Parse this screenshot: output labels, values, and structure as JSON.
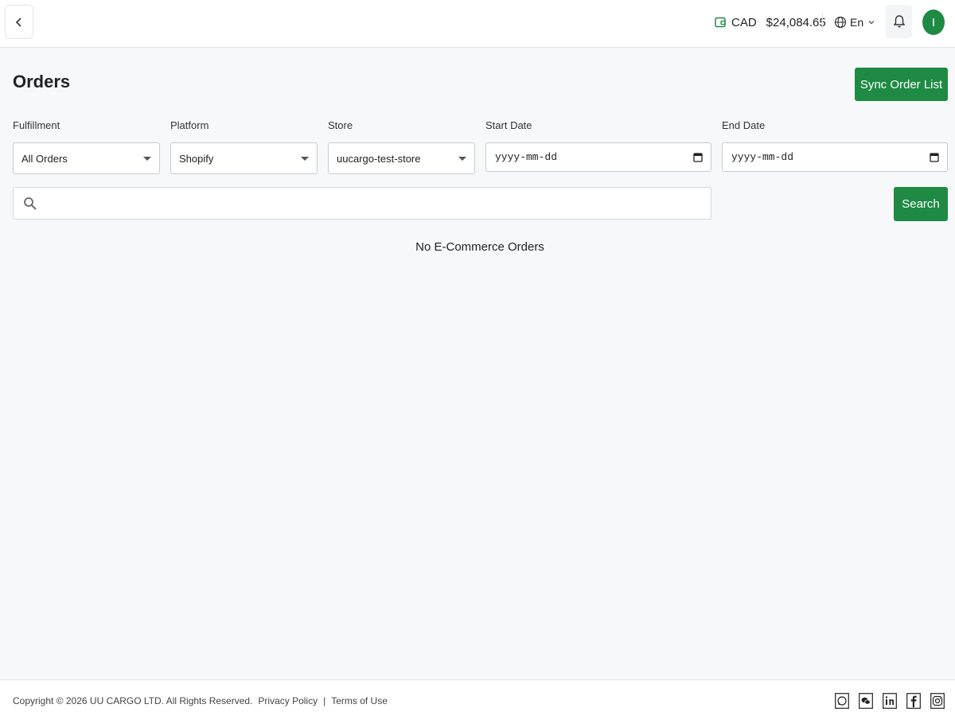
{
  "header": {
    "currency": "CAD",
    "balance": "$24,084.65",
    "language": "En",
    "avatar_initial": "I"
  },
  "page": {
    "title": "Orders",
    "sync_button": "Sync Order List"
  },
  "filters": {
    "fulfillment": {
      "label": "Fulfillment",
      "value": "All Orders"
    },
    "platform": {
      "label": "Platform",
      "value": "Shopify"
    },
    "store": {
      "label": "Store",
      "value": "uucargo-test-store"
    },
    "start_date": {
      "label": "Start Date",
      "placeholder": "yyyy-mm-dd"
    },
    "end_date": {
      "label": "End Date",
      "placeholder": "yyyy-mm-dd"
    }
  },
  "search": {
    "placeholder": "",
    "button": "Search"
  },
  "empty_message": "No E-Commerce Orders",
  "footer": {
    "copyright": "Copyright © 2026 UU CARGO LTD. All Rights Reserved.",
    "privacy": "Privacy Policy",
    "separator": "|",
    "terms": "Terms of Use",
    "social": [
      "whatsapp-icon",
      "wechat-icon",
      "linkedin-icon",
      "facebook-icon",
      "instagram-icon"
    ]
  },
  "colors": {
    "brand_green": "#1e8a44",
    "background": "#f7f8fa"
  }
}
